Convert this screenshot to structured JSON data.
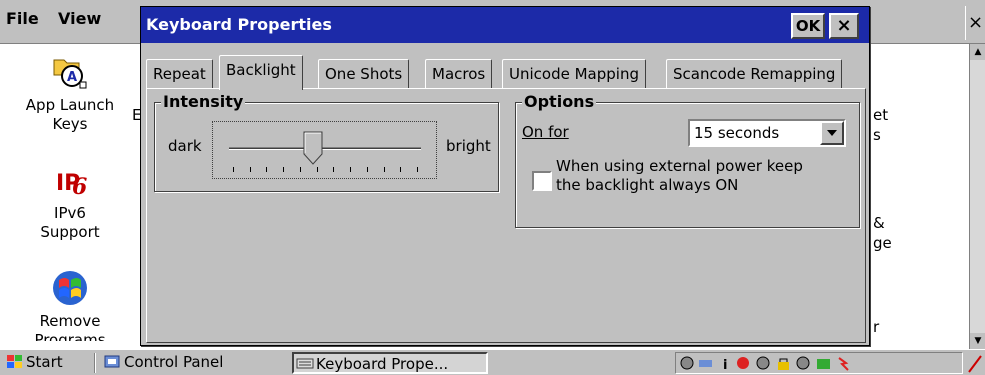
{
  "background_window": {
    "menu": [
      "File",
      "View"
    ],
    "close_label": "×",
    "icons": [
      {
        "label_line1": "App Launch",
        "label_line2": "Keys",
        "icon": "app-launch-keys-icon"
      },
      {
        "label_line1": "IPv6",
        "label_line2": "Support",
        "icon": "ipv6-icon"
      },
      {
        "label_line1": "Remove",
        "label_line2": "Programs",
        "icon": "remove-programs-icon"
      }
    ],
    "right_fragments": [
      "et",
      "s",
      "&",
      "ge",
      "r"
    ],
    "left_fragment": "E"
  },
  "dialog": {
    "title": "Keyboard Properties",
    "ok_label": "OK",
    "close_label": "×",
    "tabs": [
      "Repeat",
      "Backlight",
      "One Shots",
      "Macros",
      "Unicode Mapping",
      "Scancode Remapping"
    ],
    "active_tab": "Backlight",
    "intensity": {
      "title": "Intensity",
      "min_label": "dark",
      "max_label": "bright",
      "value_fraction": 0.44
    },
    "options": {
      "title": "Options",
      "on_for_label": "On for",
      "on_for_value": "15 seconds",
      "external_power_line1": "When using external power keep",
      "external_power_line2": "the backlight always ON",
      "external_power_checked": false
    }
  },
  "taskbar": {
    "start_label": "Start",
    "buttons": [
      "Control Panel",
      "Keyboard Prope..."
    ],
    "active_button": "Keyboard Prope..."
  },
  "colors": {
    "titlebar": "#1c2aa8",
    "face": "#c0c0c0"
  }
}
